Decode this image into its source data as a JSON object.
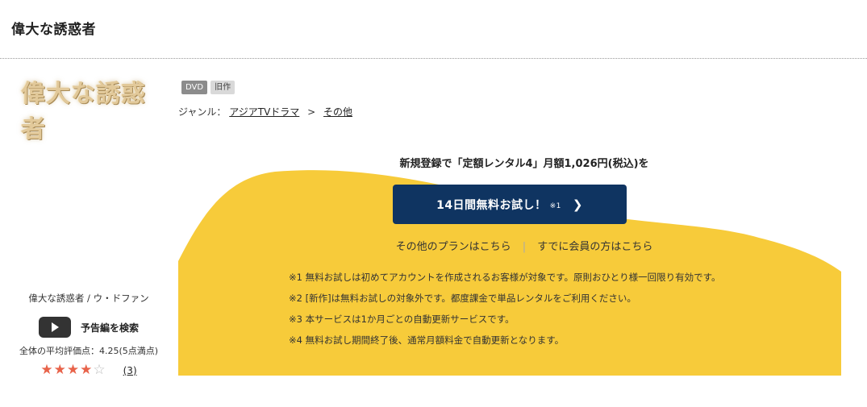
{
  "page": {
    "title": "偉大な誘惑者"
  },
  "logo": {
    "text": "偉大な誘惑者"
  },
  "badges": {
    "dvd": "DVD",
    "old": "旧作"
  },
  "genre": {
    "prefix": "ジャンル：",
    "category": "アジアTVドラマ",
    "separator": ">",
    "subcategory": "その他"
  },
  "promo": {
    "headline": "新規登録で「定額レンタル4」月額1,026円(税込)を",
    "trial_button": "14日間無料お試し！",
    "trial_note": "※1",
    "chevron": "❯"
  },
  "links": {
    "other_plans": "その他のプランはこちら",
    "divider": "|",
    "member_login": "すでに会員の方はこちら"
  },
  "notes": [
    "※1 無料お試しは初めてアカウントを作成されるお客様が対象です。原則おひとり様一回限り有効です。",
    "※2 [新作]は無料お試しの対象外です。都度課金で単品レンタルをご利用ください。",
    "※3 本サービスは1か月ごとの自動更新サービスです。",
    "※4 無料お試し期間終了後、通常月額料金で自動更新となります。"
  ],
  "sidebar": {
    "title_cast": "偉大な誘惑者 / ウ・ドファン",
    "trailer_label": "予告編を検索",
    "rating_text": "全体の平均評価点：4.25(5点満点)",
    "rating_value": 4.25,
    "review_count": "(3)"
  },
  "colors": {
    "accent_yellow": "#f7cb3a",
    "button_navy": "#0f3461",
    "star": "#e8634a"
  }
}
